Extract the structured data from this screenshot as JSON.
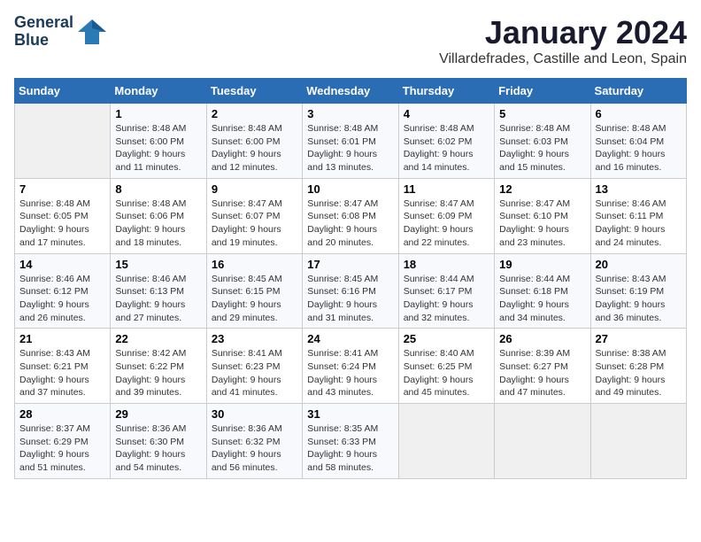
{
  "header": {
    "logo_line1": "General",
    "logo_line2": "Blue",
    "month": "January 2024",
    "location": "Villardefrades, Castille and Leon, Spain"
  },
  "weekdays": [
    "Sunday",
    "Monday",
    "Tuesday",
    "Wednesday",
    "Thursday",
    "Friday",
    "Saturday"
  ],
  "weeks": [
    [
      {
        "day": "",
        "info": ""
      },
      {
        "day": "1",
        "info": "Sunrise: 8:48 AM\nSunset: 6:00 PM\nDaylight: 9 hours\nand 11 minutes."
      },
      {
        "day": "2",
        "info": "Sunrise: 8:48 AM\nSunset: 6:00 PM\nDaylight: 9 hours\nand 12 minutes."
      },
      {
        "day": "3",
        "info": "Sunrise: 8:48 AM\nSunset: 6:01 PM\nDaylight: 9 hours\nand 13 minutes."
      },
      {
        "day": "4",
        "info": "Sunrise: 8:48 AM\nSunset: 6:02 PM\nDaylight: 9 hours\nand 14 minutes."
      },
      {
        "day": "5",
        "info": "Sunrise: 8:48 AM\nSunset: 6:03 PM\nDaylight: 9 hours\nand 15 minutes."
      },
      {
        "day": "6",
        "info": "Sunrise: 8:48 AM\nSunset: 6:04 PM\nDaylight: 9 hours\nand 16 minutes."
      }
    ],
    [
      {
        "day": "7",
        "info": "Sunrise: 8:48 AM\nSunset: 6:05 PM\nDaylight: 9 hours\nand 17 minutes."
      },
      {
        "day": "8",
        "info": "Sunrise: 8:48 AM\nSunset: 6:06 PM\nDaylight: 9 hours\nand 18 minutes."
      },
      {
        "day": "9",
        "info": "Sunrise: 8:47 AM\nSunset: 6:07 PM\nDaylight: 9 hours\nand 19 minutes."
      },
      {
        "day": "10",
        "info": "Sunrise: 8:47 AM\nSunset: 6:08 PM\nDaylight: 9 hours\nand 20 minutes."
      },
      {
        "day": "11",
        "info": "Sunrise: 8:47 AM\nSunset: 6:09 PM\nDaylight: 9 hours\nand 22 minutes."
      },
      {
        "day": "12",
        "info": "Sunrise: 8:47 AM\nSunset: 6:10 PM\nDaylight: 9 hours\nand 23 minutes."
      },
      {
        "day": "13",
        "info": "Sunrise: 8:46 AM\nSunset: 6:11 PM\nDaylight: 9 hours\nand 24 minutes."
      }
    ],
    [
      {
        "day": "14",
        "info": "Sunrise: 8:46 AM\nSunset: 6:12 PM\nDaylight: 9 hours\nand 26 minutes."
      },
      {
        "day": "15",
        "info": "Sunrise: 8:46 AM\nSunset: 6:13 PM\nDaylight: 9 hours\nand 27 minutes."
      },
      {
        "day": "16",
        "info": "Sunrise: 8:45 AM\nSunset: 6:15 PM\nDaylight: 9 hours\nand 29 minutes."
      },
      {
        "day": "17",
        "info": "Sunrise: 8:45 AM\nSunset: 6:16 PM\nDaylight: 9 hours\nand 31 minutes."
      },
      {
        "day": "18",
        "info": "Sunrise: 8:44 AM\nSunset: 6:17 PM\nDaylight: 9 hours\nand 32 minutes."
      },
      {
        "day": "19",
        "info": "Sunrise: 8:44 AM\nSunset: 6:18 PM\nDaylight: 9 hours\nand 34 minutes."
      },
      {
        "day": "20",
        "info": "Sunrise: 8:43 AM\nSunset: 6:19 PM\nDaylight: 9 hours\nand 36 minutes."
      }
    ],
    [
      {
        "day": "21",
        "info": "Sunrise: 8:43 AM\nSunset: 6:21 PM\nDaylight: 9 hours\nand 37 minutes."
      },
      {
        "day": "22",
        "info": "Sunrise: 8:42 AM\nSunset: 6:22 PM\nDaylight: 9 hours\nand 39 minutes."
      },
      {
        "day": "23",
        "info": "Sunrise: 8:41 AM\nSunset: 6:23 PM\nDaylight: 9 hours\nand 41 minutes."
      },
      {
        "day": "24",
        "info": "Sunrise: 8:41 AM\nSunset: 6:24 PM\nDaylight: 9 hours\nand 43 minutes."
      },
      {
        "day": "25",
        "info": "Sunrise: 8:40 AM\nSunset: 6:25 PM\nDaylight: 9 hours\nand 45 minutes."
      },
      {
        "day": "26",
        "info": "Sunrise: 8:39 AM\nSunset: 6:27 PM\nDaylight: 9 hours\nand 47 minutes."
      },
      {
        "day": "27",
        "info": "Sunrise: 8:38 AM\nSunset: 6:28 PM\nDaylight: 9 hours\nand 49 minutes."
      }
    ],
    [
      {
        "day": "28",
        "info": "Sunrise: 8:37 AM\nSunset: 6:29 PM\nDaylight: 9 hours\nand 51 minutes."
      },
      {
        "day": "29",
        "info": "Sunrise: 8:36 AM\nSunset: 6:30 PM\nDaylight: 9 hours\nand 54 minutes."
      },
      {
        "day": "30",
        "info": "Sunrise: 8:36 AM\nSunset: 6:32 PM\nDaylight: 9 hours\nand 56 minutes."
      },
      {
        "day": "31",
        "info": "Sunrise: 8:35 AM\nSunset: 6:33 PM\nDaylight: 9 hours\nand 58 minutes."
      },
      {
        "day": "",
        "info": ""
      },
      {
        "day": "",
        "info": ""
      },
      {
        "day": "",
        "info": ""
      }
    ]
  ]
}
